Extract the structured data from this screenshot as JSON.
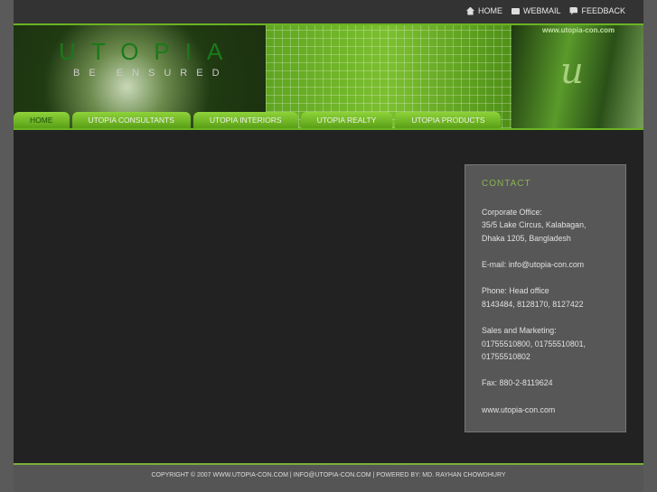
{
  "top_links": [
    {
      "label": "HOME",
      "icon": "home-icon"
    },
    {
      "label": "WEBMAIL",
      "icon": "mail-icon"
    },
    {
      "label": "FEEDBACK",
      "icon": "feedback-icon"
    }
  ],
  "banner": {
    "logo": "UTOPIA",
    "tagline": "BE ENSURED",
    "url": "www.utopia-con.com",
    "mark": "u"
  },
  "nav": [
    "HOME",
    "UTOPIA CONSULTANTS",
    "UTOPIA INTERIORS",
    "UTOPIA REALTY",
    "UTOPIA PRODUCTS"
  ],
  "contact": {
    "title": "CONTACT",
    "office_label": "Corporate Office:",
    "address1": "35/5 Lake Circus, Kalabagan,",
    "address2": "Dhaka 1205, Bangladesh",
    "email": "E-mail: info@utopia-con.com",
    "phone_label": "Phone: Head office",
    "phones": "8143484, 8128170, 8127422",
    "sales_label": "Sales and Marketing:",
    "sales1": "01755510800, 01755510801,",
    "sales2": "01755510802",
    "fax": "Fax: 880-2-8119624",
    "web": "www.utopia-con.com"
  },
  "footer": "COPYRIGHT © 2007 WWW.UTOPIA-CON.COM | INFO@UTOPIA-CON.COM | POWERED BY: MD. RAYHAN CHOWDHURY"
}
